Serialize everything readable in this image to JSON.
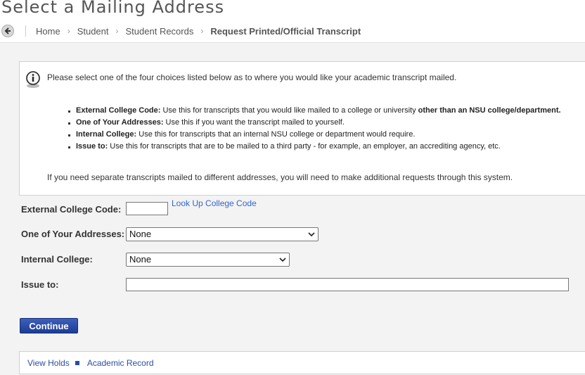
{
  "page": {
    "title": "Select a Mailing Address"
  },
  "breadcrumb": {
    "items": [
      "Home",
      "Student",
      "Student Records"
    ],
    "current": "Request Printed/Official Transcript",
    "separator": "›"
  },
  "info": {
    "intro": "Please select one of the four choices listed below as to where you would like your academic transcript mailed.",
    "choices": [
      {
        "term": "External College Code:",
        "text": " Use this for transcripts that you would like mailed to a college or university ",
        "emphasis": "other than an NSU college/department."
      },
      {
        "term": "One of Your Addresses:",
        "text": " Use this if you want the transcript mailed to yourself.",
        "emphasis": ""
      },
      {
        "term": "Internal College:",
        "text": " Use this for transcripts that an internal NSU college or department would require.",
        "emphasis": ""
      },
      {
        "term": "Issue to:",
        "text": " Use this for transcripts that are to be mailed to a third party - for example, an employer, an accrediting agency, etc.",
        "emphasis": ""
      }
    ],
    "footer": "If you need separate transcripts mailed to different addresses, you will need to make additional requests through this system."
  },
  "form": {
    "external_code_label": "External College Code:",
    "external_code_value": "",
    "lookup_link": "Look Up College Code",
    "addresses_label": "One of Your Addresses:",
    "addresses_selected": "None",
    "internal_label": "Internal College:",
    "internal_selected": "None",
    "issue_to_label": "Issue to:",
    "issue_to_value": "",
    "continue_label": "Continue"
  },
  "footer_links": {
    "items": [
      "View Holds",
      "Academic Record"
    ]
  },
  "colors": {
    "accent": "#1c3d95",
    "link": "#3366cc",
    "background": "#f3f3f3"
  },
  "icons": [
    "back-arrow-icon",
    "info-icon",
    "chevron-down-icon"
  ]
}
